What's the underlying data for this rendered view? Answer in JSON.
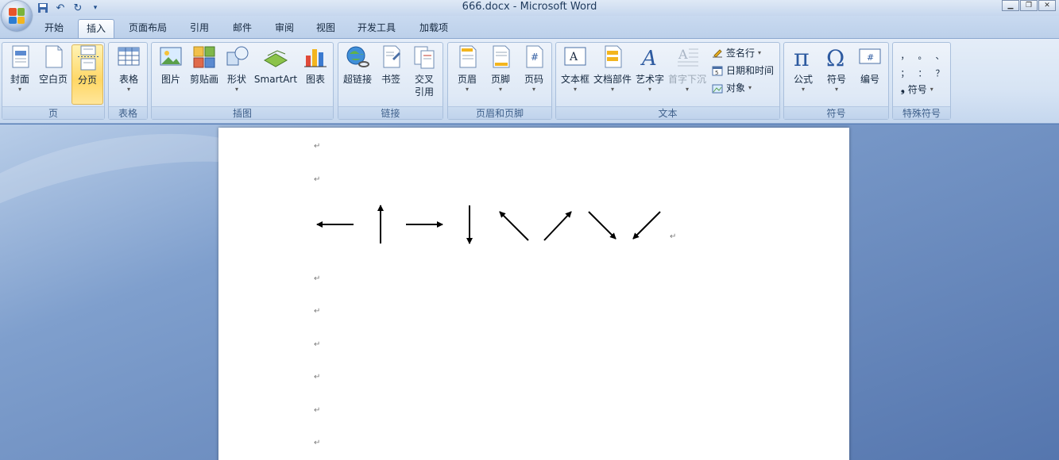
{
  "window": {
    "title": "666.docx - Microsoft Word",
    "controls": [
      "minimize",
      "restore",
      "close"
    ]
  },
  "quick_access": {
    "icons": [
      "save-icon",
      "undo-icon",
      "redo-icon",
      "customize-icon"
    ]
  },
  "tabs": [
    {
      "label": "开始",
      "active": false
    },
    {
      "label": "插入",
      "active": true
    },
    {
      "label": "页面布局",
      "active": false
    },
    {
      "label": "引用",
      "active": false
    },
    {
      "label": "邮件",
      "active": false
    },
    {
      "label": "审阅",
      "active": false
    },
    {
      "label": "视图",
      "active": false
    },
    {
      "label": "开发工具",
      "active": false
    },
    {
      "label": "加载项",
      "active": false
    }
  ],
  "ribbon": {
    "groups": {
      "page": {
        "label": "页",
        "buttons": [
          "封面",
          "空白页",
          "分页"
        ]
      },
      "table": {
        "label": "表格",
        "buttons": [
          "表格"
        ]
      },
      "illustrations": {
        "label": "插图",
        "buttons": [
          "图片",
          "剪贴画",
          "形状",
          "SmartArt",
          "图表"
        ]
      },
      "links": {
        "label": "链接",
        "buttons": [
          "超链接",
          "书签",
          "交叉",
          "引用"
        ]
      },
      "header_footer": {
        "label": "页眉和页脚",
        "buttons": [
          "页眉",
          "页脚",
          "页码"
        ]
      },
      "text": {
        "label": "文本",
        "buttons": [
          "文本框",
          "文档部件",
          "艺术字",
          "首字下沉"
        ],
        "small": [
          "签名行",
          "日期和时间",
          "对象"
        ]
      },
      "symbols": {
        "label": "符号",
        "buttons": [
          "公式",
          "符号",
          "编号"
        ]
      },
      "special_symbols": {
        "label": "特殊符号",
        "chars": [
          "，",
          "。",
          "、",
          "；",
          "：",
          "？"
        ],
        "button": "符号"
      }
    }
  },
  "document": {
    "paragraph_mark": "↵",
    "arrows": [
      "←",
      "↑",
      "→",
      "↓",
      "↖",
      "↗",
      "↘",
      "↙"
    ]
  },
  "colors": {
    "ribbon_bg": "#dfe9f6",
    "selected_button": "#ffd766",
    "doc_background": "#5a80b8"
  }
}
